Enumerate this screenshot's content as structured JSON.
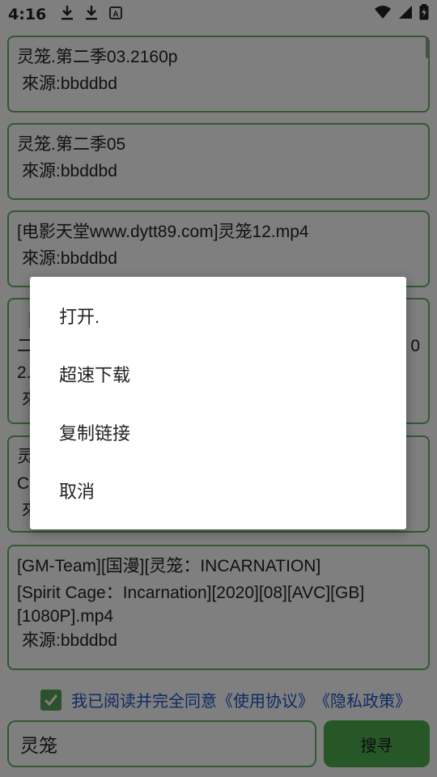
{
  "status_bar": {
    "time": "4:16",
    "icons": [
      "download-icon",
      "download-icon",
      "font-a-icon"
    ],
    "right_icons": [
      "wifi-icon",
      "cell-signal-icon",
      "battery-charging-icon"
    ]
  },
  "results": [
    {
      "title": "灵笼.第二季03.2160p",
      "source": "來源:bbddbd"
    },
    {
      "title": "灵笼.第二季05",
      "source": "來源:bbddbd"
    },
    {
      "title": "[电影天堂www.dytt89.com]灵笼12.mp4",
      "source": "來源:bbddbd"
    },
    {
      "line1": "[",
      "line2": "二",
      "line2_tail": "0",
      "line3": "2.",
      "source_frag": "來"
    },
    {
      "line1": "灵",
      "line2": "C",
      "source_frag": "來"
    },
    {
      "title_line1": "[GM-Team][国漫][灵笼：INCARNATION]",
      "title_line2": "[Spirit Cage：Incarnation][2020][08][AVC][GB]",
      "title_line3": "[1080P].mp4",
      "source": "來源:bbddbd"
    }
  ],
  "agreement": {
    "checked": true,
    "text": "我已阅读并完全同意",
    "terms_link": "《使用协议》",
    "privacy_link": "《隐私政策》"
  },
  "search": {
    "value": "灵笼",
    "button_label": "搜寻"
  },
  "dialog": {
    "items": [
      "打开.",
      "超速下载",
      "复制链接",
      "取消"
    ]
  },
  "colors": {
    "accent": "#4fad4f",
    "border": "#64b464",
    "link": "#1e57c8"
  }
}
